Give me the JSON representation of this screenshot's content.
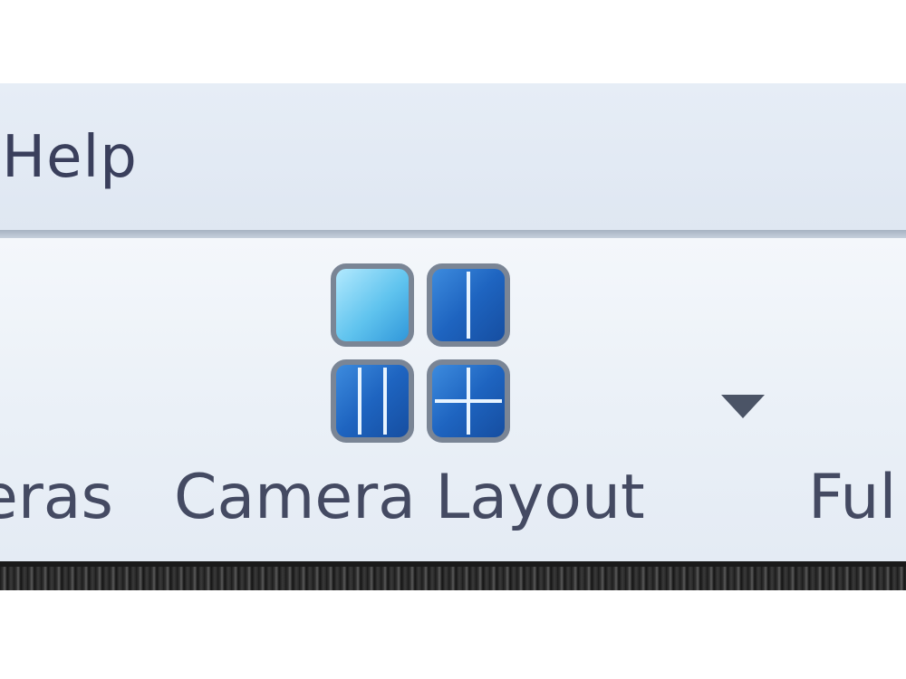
{
  "menubar": {
    "items": [
      {
        "label": "Help"
      }
    ]
  },
  "ribbon": {
    "buttons": [
      {
        "label": "eras",
        "icon": "cameras-icon"
      },
      {
        "label": "Camera Layout",
        "icon": "camera-layout-grid-icon",
        "has_dropdown": true
      },
      {
        "label": "Ful",
        "icon": "fullscreen-icon"
      }
    ]
  },
  "colors": {
    "menubar_bg": "#e3eaf4",
    "ribbon_bg": "#eef2f8",
    "text": "#444a62",
    "icon_blue_dark": "#1b5fb8",
    "icon_blue_light": "#7fd0f2"
  }
}
